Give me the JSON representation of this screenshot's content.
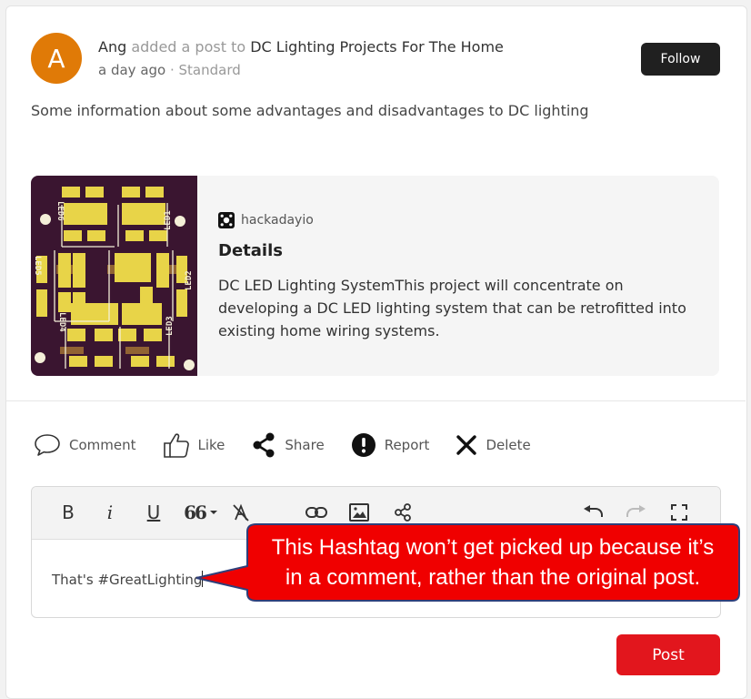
{
  "post": {
    "avatar_letter": "A",
    "author": "Ang",
    "action_text": " added a post to ",
    "group": "DC Lighting Projects For The Home",
    "time": "a day ago",
    "separator": " · ",
    "post_type": "Standard",
    "follow_label": "Follow",
    "body": "Some information about some advantages and disadvantages to DC lighting"
  },
  "link_preview": {
    "site": "hackadayio",
    "title": "Details",
    "description": "DC LED Lighting SystemThis project will concentrate on developing a DC LED lighting system that can be retrofitted into existing home wiring systems.",
    "pcb_labels": [
      "LED6",
      "LED1",
      "LED5",
      "LED2",
      "LED4",
      "LED3"
    ]
  },
  "actions": [
    {
      "label": "Comment",
      "icon": "comment-icon"
    },
    {
      "label": "Like",
      "icon": "thumbs-up-icon"
    },
    {
      "label": "Share",
      "icon": "share-icon"
    },
    {
      "label": "Report",
      "icon": "report-icon"
    },
    {
      "label": "Delete",
      "icon": "close-icon"
    }
  ],
  "editor": {
    "bold": "B",
    "italic": "i",
    "underline": "U",
    "quote": "66",
    "comment_text": "That's #GreatLighting"
  },
  "callout": {
    "line1": "This Hashtag won’t get picked up because it’s",
    "line2": "in a comment, rather than the original post."
  },
  "post_button": "Post",
  "colors": {
    "avatar": "#e07a07",
    "follow_bg": "#202020",
    "post_button": "#e2161d",
    "callout": "#f00000",
    "pcb": "#3a1530",
    "pad": "#e8d448"
  }
}
